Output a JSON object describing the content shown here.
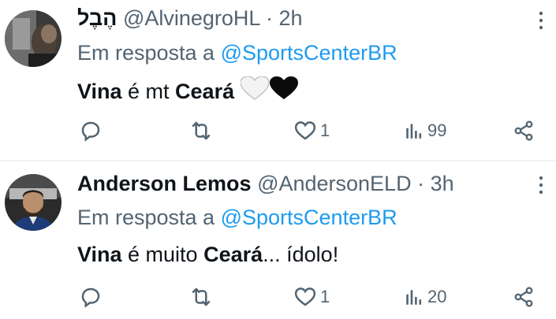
{
  "tweets": [
    {
      "display_name": "הֶבֶל",
      "handle": "@AlvinegroHL",
      "separator": "·",
      "time": "2h",
      "reply_prefix": "Em resposta a",
      "reply_to": "@SportsCenterBR",
      "body_bold_1": "Vina",
      "body_text_1": " é mt ",
      "body_bold_2": "Ceará",
      "body_emoji": "🤍🖤",
      "likes": "1",
      "views": "99"
    },
    {
      "display_name": "Anderson Lemos",
      "handle": "@AndersonELD",
      "separator": "·",
      "time": "3h",
      "reply_prefix": "Em resposta a",
      "reply_to": "@SportsCenterBR",
      "body_bold_1": "Vina",
      "body_text_1": " é muito ",
      "body_bold_2": "Ceará",
      "body_text_2": "... ídolo!",
      "likes": "1",
      "views": "20"
    }
  ],
  "colors": {
    "text": "#0f1419",
    "secondary": "#536471",
    "link": "#1d9bf0",
    "divider": "#eff3f4"
  },
  "icons": [
    "reply-icon",
    "retweet-icon",
    "like-icon",
    "views-icon",
    "share-icon",
    "more-icon"
  ]
}
